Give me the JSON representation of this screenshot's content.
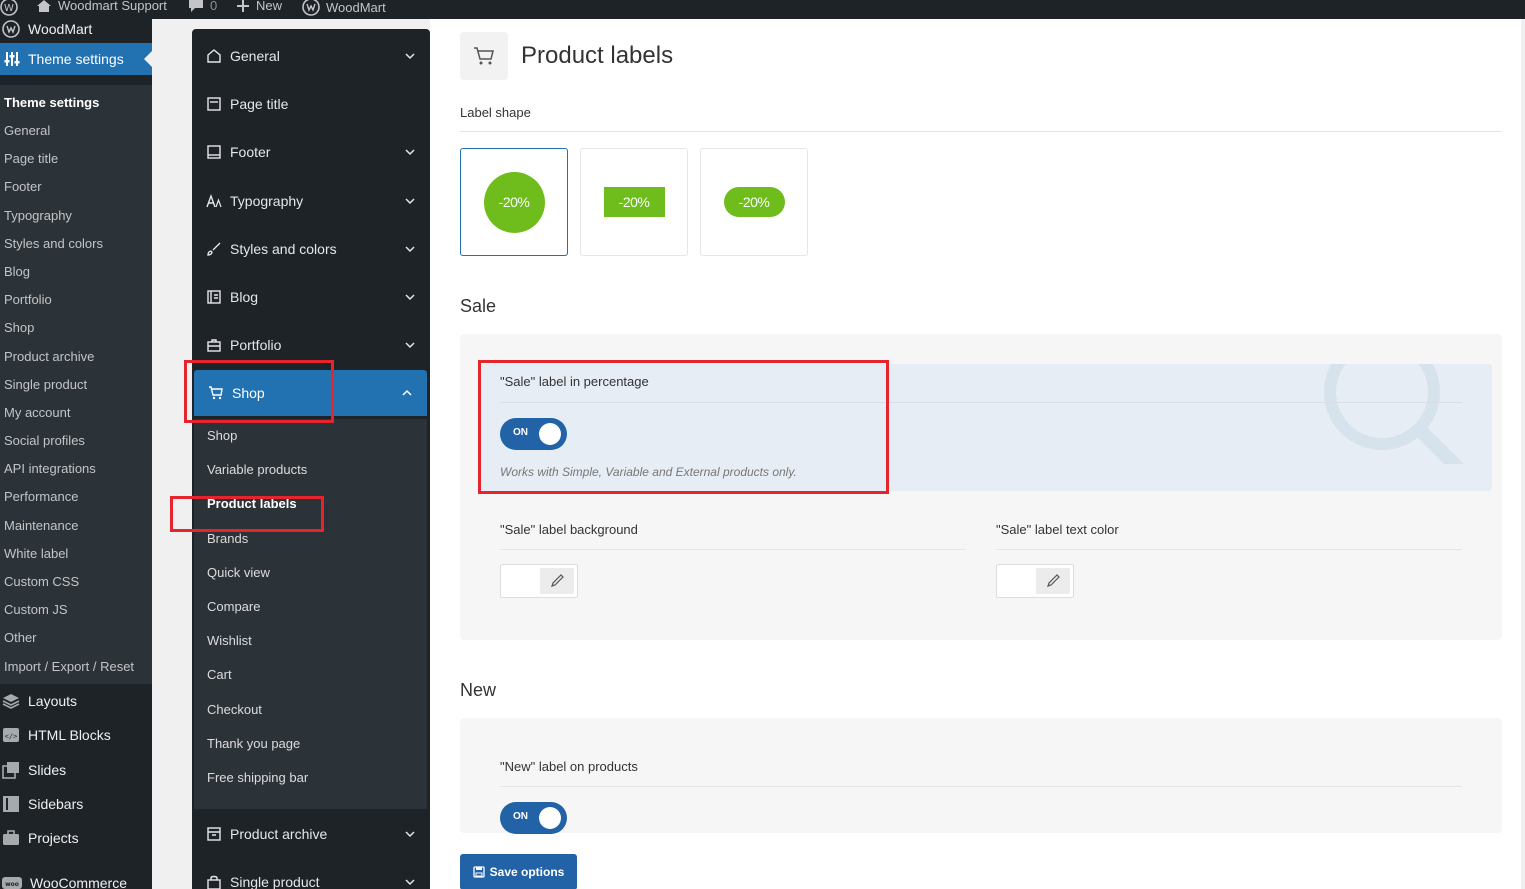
{
  "adminbar": {
    "site_name": "Woodmart Support",
    "comments_count": "0",
    "new_label": "New",
    "woodmart_label": "WoodMart"
  },
  "wp_menu": {
    "site_label": "WoodMart",
    "theme_settings": "Theme settings",
    "submenu_heading": "Theme settings",
    "submenu_items": [
      "General",
      "Page title",
      "Footer",
      "Typography",
      "Styles and colors",
      "Blog",
      "Portfolio",
      "Shop",
      "Product archive",
      "Single product",
      "My account",
      "Social profiles",
      "API integrations",
      "Performance",
      "Maintenance",
      "White label",
      "Custom CSS",
      "Custom JS",
      "Other",
      "Import / Export / Reset"
    ],
    "main_items": [
      "Layouts",
      "HTML Blocks",
      "Slides",
      "Sidebars",
      "Projects",
      "WooCommerce"
    ]
  },
  "options_sidebar": {
    "sections": [
      "General",
      "Page title",
      "Footer",
      "Typography",
      "Styles and colors",
      "Blog",
      "Portfolio",
      "Shop"
    ],
    "shop_subsections": [
      "Shop",
      "Variable products",
      "Product labels",
      "Brands",
      "Quick view",
      "Compare",
      "Wishlist",
      "Cart",
      "Checkout",
      "Thank you page",
      "Free shipping bar"
    ],
    "after_sections": [
      "Product archive",
      "Single product"
    ]
  },
  "content": {
    "page_title": "Product labels",
    "label_shape": {
      "label": "Label shape",
      "options": [
        "-20%",
        "-20%",
        "-20%"
      ],
      "selected_index": 0
    },
    "sale": {
      "title": "Sale",
      "percentage_label": "\"Sale\" label in percentage",
      "toggle": "ON",
      "hint": "Works with Simple, Variable and External products only.",
      "background_label": "\"Sale\" label background",
      "text_color_label": "\"Sale\" label text color"
    },
    "new": {
      "title": "New",
      "on_products_label": "\"New\" label on products",
      "toggle": "ON"
    },
    "save_button": "Save options"
  },
  "colors": {
    "accent": "#2271b1",
    "label_green": "#6ebd1d",
    "annotation_red": "#e5242c",
    "toggle_blue": "#2262a7"
  }
}
